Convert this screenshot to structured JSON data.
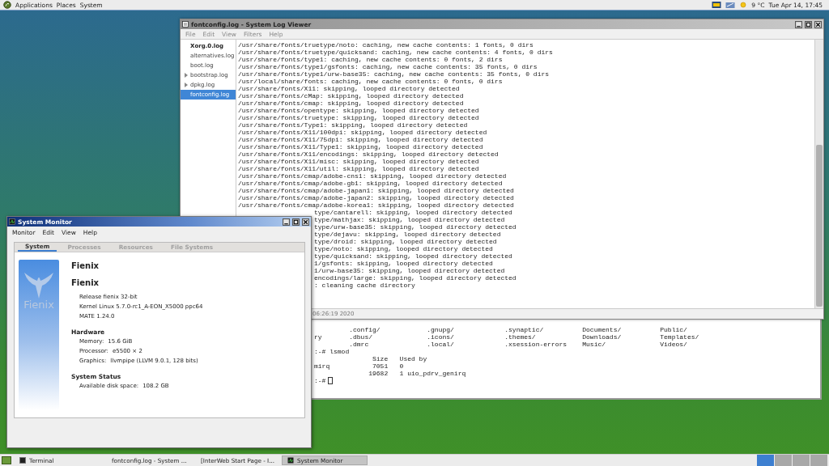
{
  "top_panel": {
    "menus": [
      "Applications",
      "Places",
      "System"
    ],
    "temperature": "9 °C",
    "clock": "Tue Apr 14, 17:45"
  },
  "log_viewer": {
    "title": "fontconfig.log - System Log Viewer",
    "menus": [
      "File",
      "Edit",
      "View",
      "Filters",
      "Help"
    ],
    "files": [
      {
        "name": "Xorg.0.log",
        "selected": false,
        "updated": true,
        "expandable": false
      },
      {
        "name": "alternatives.log",
        "selected": false,
        "updated": false,
        "expandable": false
      },
      {
        "name": "boot.log",
        "selected": false,
        "updated": false,
        "expandable": false
      },
      {
        "name": "bootstrap.log",
        "selected": false,
        "updated": false,
        "expandable": true
      },
      {
        "name": "dpkg.log",
        "selected": false,
        "updated": false,
        "expandable": true
      },
      {
        "name": "fontconfig.log",
        "selected": true,
        "updated": false,
        "expandable": false
      }
    ],
    "lines": [
      "/usr/share/fonts/truetype/noto: caching, new cache contents: 1 fonts, 0 dirs",
      "/usr/share/fonts/truetype/quicksand: caching, new cache contents: 4 fonts, 0 dirs",
      "/usr/share/fonts/type1: caching, new cache contents: 0 fonts, 2 dirs",
      "/usr/share/fonts/type1/gsfonts: caching, new cache contents: 35 fonts, 0 dirs",
      "/usr/share/fonts/type1/urw-base35: caching, new cache contents: 35 fonts, 0 dirs",
      "/usr/local/share/fonts: caching, new cache contents: 0 fonts, 0 dirs",
      "/usr/share/fonts/X11: skipping, looped directory detected",
      "/usr/share/fonts/cMap: skipping, looped directory detected",
      "/usr/share/fonts/cmap: skipping, looped directory detected",
      "/usr/share/fonts/opentype: skipping, looped directory detected",
      "/usr/share/fonts/truetype: skipping, looped directory detected",
      "/usr/share/fonts/Type1: skipping, looped directory detected",
      "/usr/share/fonts/X11/100dpi: skipping, looped directory detected",
      "/usr/share/fonts/X11/75dpi: skipping, looped directory detected",
      "/usr/share/fonts/X11/Type1: skipping, looped directory detected",
      "/usr/share/fonts/X11/encodings: skipping, looped directory detected",
      "/usr/share/fonts/X11/misc: skipping, looped directory detected",
      "/usr/share/fonts/X11/util: skipping, looped directory detected",
      "/usr/share/fonts/cmap/adobe-cns1: skipping, looped directory detected",
      "/usr/share/fonts/cmap/adobe-gb1: skipping, looped directory detected",
      "/usr/share/fonts/cmap/adobe-japan1: skipping, looped directory detected",
      "/usr/share/fonts/cmap/adobe-japan2: skipping, looped directory detected",
      "/usr/share/fonts/cmap/adobe-korea1: skipping, looped directory detected"
    ],
    "line_ends_beside_window": [
      "type/cantarell: skipping, looped directory detected",
      "type/mathjax: skipping, looped directory detected",
      "type/urw-base35: skipping, looped directory detected",
      "type/dejavu: skipping, looped directory detected",
      "type/droid: skipping, looped directory detected",
      "type/noto: skipping, looped directory detected",
      "type/quicksand: skipping, looped directory detected",
      "1/gsfonts: skipping, looped directory detected",
      "1/urw-base35: skipping, looped directory detected",
      "encodings/large: skipping, looped directory detected",
      ": cleaning cache directory"
    ],
    "status": "06:26:19 2020"
  },
  "terminal": {
    "lines": [
      "         .config/            .gnupg/             .synaptic/          Documents/          Public/",
      "ry       .dbus/              .icons/             .themes/            Downloads/          Templates/",
      "         .dmrc               .local/             .xsession-errors    Music/              Videos/",
      ":-# lsmod",
      "               Size   Used by",
      "mirq           7051   0",
      "              19682   1 uio_pdrv_genirq"
    ],
    "prompt": ":-#"
  },
  "system_monitor": {
    "title": "System Monitor",
    "menus": [
      "Monitor",
      "Edit",
      "View",
      "Help"
    ],
    "tabs": [
      {
        "label": "System",
        "selected": true
      },
      {
        "label": "Processes",
        "selected": false
      },
      {
        "label": "Resources",
        "selected": false
      },
      {
        "label": "File Systems",
        "selected": false
      }
    ],
    "logo_text": "Fienix",
    "host_name": "Fienix",
    "distro_name": "Fienix",
    "info": [
      "Release fienix 32-bit",
      "Kernel Linux 5.7.0-rc1_A-EON_X5000 ppc64",
      "MATE 1.24.0"
    ],
    "sections": [
      {
        "heading": "Hardware",
        "rows": [
          {
            "label": "Memory:",
            "value": "15.6 GiB"
          },
          {
            "label": "Processor:",
            "value": "e5500 × 2"
          },
          {
            "label": "Graphics:",
            "value": "llvmpipe (LLVM 9.0.1, 128 bits)"
          }
        ]
      },
      {
        "heading": "System Status",
        "rows": [
          {
            "label": "Available disk space:",
            "value": "108.2 GB"
          }
        ]
      }
    ]
  },
  "taskbar": {
    "items": [
      {
        "label": "Terminal",
        "selected": false,
        "kind": "terminal"
      },
      {
        "label": "fontconfig.log - System ...",
        "selected": false,
        "kind": "log"
      },
      {
        "label": "[InterWeb Start Page - I...",
        "selected": false,
        "kind": "browser"
      },
      {
        "label": "System Monitor",
        "selected": true,
        "kind": "monitor"
      }
    ],
    "workspaces": [
      {
        "selected": true
      },
      {
        "selected": false
      },
      {
        "selected": false
      },
      {
        "selected": false
      }
    ]
  }
}
